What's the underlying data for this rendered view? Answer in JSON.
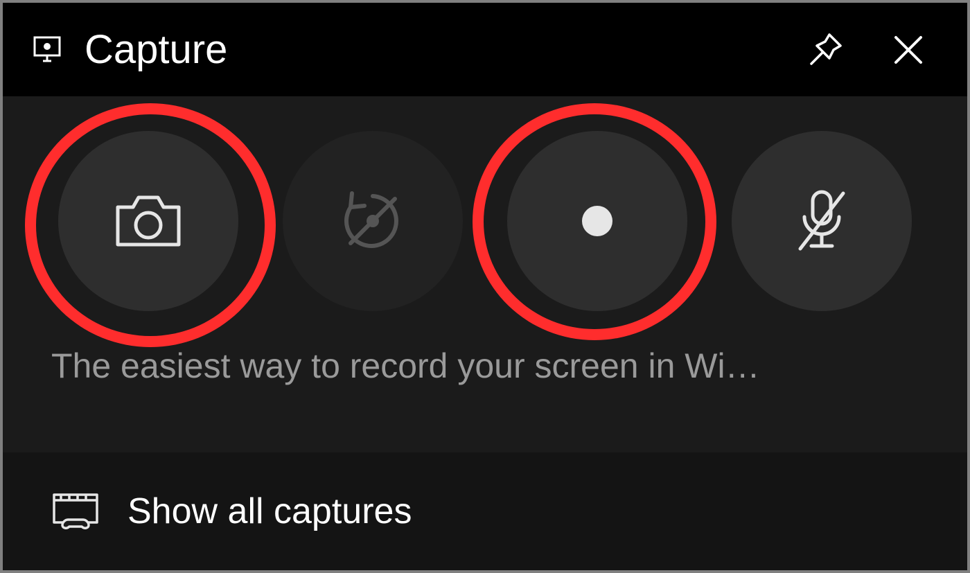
{
  "titlebar": {
    "title": "Capture"
  },
  "body": {
    "status_text": "The easiest way to record your screen in Wi…"
  },
  "footer": {
    "show_all_label": "Show all captures"
  },
  "icons": {
    "title": "capture-monitor-icon",
    "pin": "pin-icon",
    "close": "close-icon",
    "screenshot": "camera-icon",
    "replay": "record-last-icon",
    "record": "record-icon",
    "mic": "mic-muted-icon",
    "gallery": "gallery-icon"
  },
  "colors": {
    "highlight": "#ff2d2d",
    "window_bg": "#000000",
    "body_bg": "#1b1b1b",
    "footer_bg": "#141414",
    "button_bg": "#2e2e2e",
    "text_primary": "#ffffff",
    "text_secondary": "#9a9a9a"
  }
}
